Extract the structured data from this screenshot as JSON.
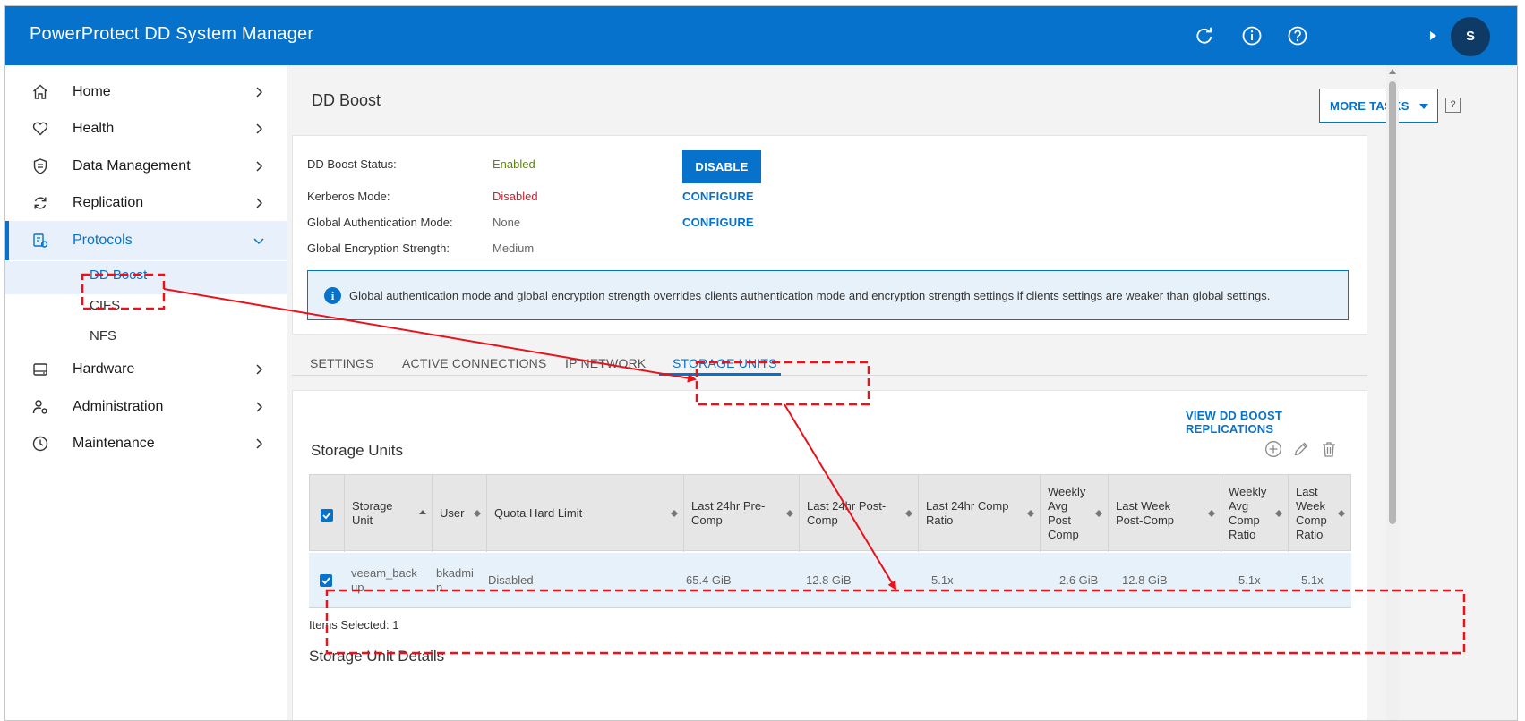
{
  "header": {
    "app_title": "PowerProtect DD System Manager",
    "avatar_initial": "S",
    "brand_color": "#0672cb"
  },
  "sidebar": {
    "items": [
      {
        "label": "Home",
        "icon": "home-icon"
      },
      {
        "label": "Health",
        "icon": "heart-icon"
      },
      {
        "label": "Data Management",
        "icon": "shield-icon"
      },
      {
        "label": "Replication",
        "icon": "sync-icon"
      },
      {
        "label": "Protocols",
        "icon": "protocols-icon",
        "expanded": true
      },
      {
        "label": "Hardware",
        "icon": "hard-drive-icon"
      },
      {
        "label": "Administration",
        "icon": "admin-user-gear-icon"
      },
      {
        "label": "Maintenance",
        "icon": "clock-gauge-icon"
      }
    ],
    "protocol_subitems": [
      "DD Boost",
      "CIFS",
      "NFS"
    ]
  },
  "page": {
    "title": "DD Boost",
    "more_tasks_label": "MORE TASKS",
    "help_label": "?"
  },
  "status": {
    "boost_status_label": "DD Boost Status:",
    "boost_status_value": "Enabled",
    "disable_button": "DISABLE",
    "kerberos_label": "Kerberos Mode:",
    "kerberos_value": "Disabled",
    "global_auth_label": "Global Authentication Mode:",
    "global_auth_value": "None",
    "global_enc_label": "Global Encryption Strength:",
    "global_enc_value": "Medium",
    "configure_label": "CONFIGURE",
    "enabled_color": "#5a8a00",
    "disabled_color": "#d31e2a"
  },
  "info": {
    "message": "Global authentication mode and global encryption strength overrides clients authentication mode and encryption strength settings if clients settings are weaker than global settings."
  },
  "tabs": [
    "SETTINGS",
    "ACTIVE CONNECTIONS",
    "IP NETWORK",
    "STORAGE UNITS"
  ],
  "storage_units": {
    "view_replications_link": "VIEW DD BOOST REPLICATIONS",
    "title": "Storage Units",
    "columns": [
      "Storage Unit",
      "User",
      "Quota Hard Limit",
      "Last 24hr Pre-Comp",
      "Last 24hr Post-Comp",
      "Last 24hr Comp Ratio",
      "Weekly Avg Post Comp",
      "Last Week Post-Comp",
      "Weekly Avg Comp Ratio",
      "Last Week Comp Ratio"
    ],
    "rows": [
      {
        "storage_unit": "veeam_backup",
        "user": "bkadmin",
        "quota": "Disabled",
        "pre_comp_24": "65.4 GiB",
        "post_comp_24": "12.8 GiB",
        "ratio_24": "5.1x",
        "weekly_avg_post": "2.6 GiB",
        "last_week_post": "12.8 GiB",
        "weekly_avg_ratio": "5.1x",
        "last_week_ratio": "5.1x"
      }
    ],
    "items_selected": "Items Selected: 1",
    "details_title": "Storage Unit Details"
  },
  "annotation_color": "#e8121b"
}
